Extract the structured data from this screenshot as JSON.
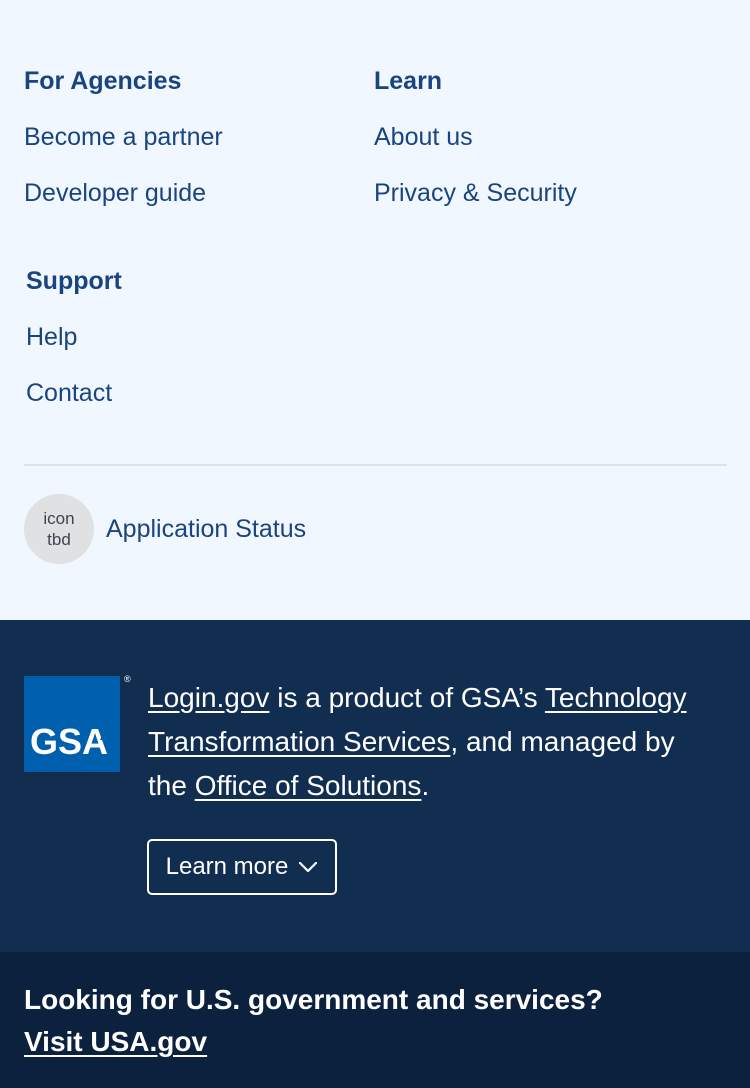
{
  "footer_nav": {
    "agencies": {
      "heading": "For Agencies",
      "links": [
        "Become a partner",
        "Developer guide"
      ]
    },
    "learn": {
      "heading": "Learn",
      "links": [
        "About us",
        "Privacy & Security"
      ]
    },
    "support": {
      "heading": "Support",
      "links": [
        "Help",
        "Contact"
      ]
    }
  },
  "app_status": {
    "icon_line1": "icon",
    "icon_line2": "tbd",
    "label": "Application Status"
  },
  "gsa": {
    "logo_text": "GSA",
    "registered_mark": "®",
    "login_link": "Login.gov",
    "text1": " is a product of GSA’s ",
    "tts_link": "Technology Transformation Services",
    "text2": ", and managed by the ",
    "oos_link": "Office of Solutions",
    "text3": ".",
    "learn_more": "Learn more"
  },
  "usa_gov": {
    "question": "Looking for U.S. government and services?",
    "link": "Visit USA.gov"
  },
  "colors": {
    "primary": "#1a4480",
    "navy": "#112e51",
    "darkest": "#0b213e",
    "light_bg": "#f0f7fe",
    "gsa_blue": "#0060ae"
  }
}
